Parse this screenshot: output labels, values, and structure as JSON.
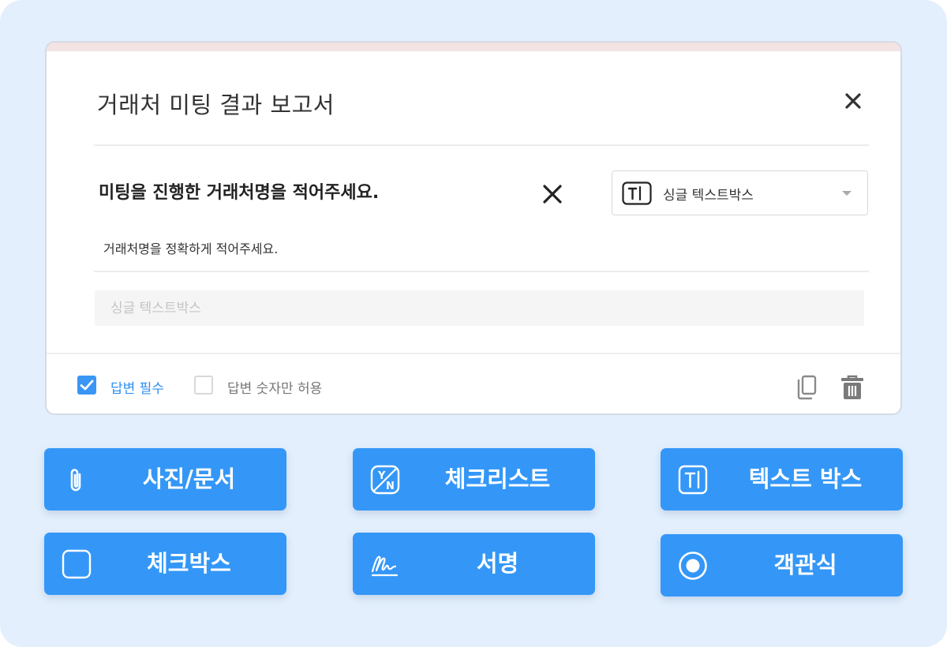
{
  "form_card": {
    "title": "거래처 미팅 결과 보고서",
    "question": {
      "title": "미팅을 진행한 거래처명을 적어주세요.",
      "description": "거래처명을 정확하게 적어주세요.",
      "type_select": {
        "icon": "text-box-icon",
        "value": "싱글 텍스트박스"
      },
      "answer_placeholder": "싱글 텍스트박스"
    },
    "options": [
      {
        "label": "답변 필수",
        "checked": true
      },
      {
        "label": "답변 숫자만 허용",
        "checked": false
      }
    ]
  },
  "tools": [
    {
      "label": "사진/문서",
      "icon": "paperclip-icon"
    },
    {
      "label": "체크리스트",
      "icon": "yes-no-icon"
    },
    {
      "label": "텍스트 박스",
      "icon": "text-box-icon"
    },
    {
      "label": "체크박스",
      "icon": "checkbox-icon"
    },
    {
      "label": "서명",
      "icon": "signature-icon"
    },
    {
      "label": "객관식",
      "icon": "radio-icon"
    }
  ],
  "colors": {
    "accent": "#3497f7",
    "background": "#e3effc",
    "card_top_bar": "#f3e3e3"
  }
}
